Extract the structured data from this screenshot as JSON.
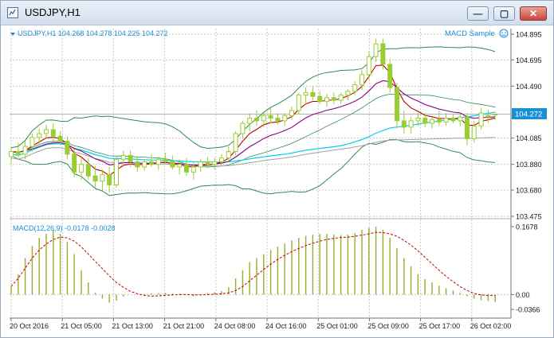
{
  "window": {
    "title": "USDJPY,H1",
    "buttons": {
      "minimize": "—",
      "restore": "▢",
      "close": "✕"
    }
  },
  "chart_data": {
    "type": "candlestick",
    "title": "USDJPY,H1",
    "header_values": "104.268 104.278 104.225 104.272",
    "header_label": "USDJPY,H1  104.268 104.278 104.225 104.272",
    "indicator_label": "MACD Sample",
    "current_price": "104.272",
    "price_ticks": [
      "104.895",
      "104.695",
      "104.490",
      "104.085",
      "103.880",
      "103.680",
      "103.475"
    ],
    "ylim": [
      103.475,
      104.895
    ],
    "x_ticks": [
      "20 Oct 2016",
      "21 Oct 05:00",
      "21 Oct 13:00",
      "21 Oct 21:00",
      "24 Oct 08:00",
      "24 Oct 16:00",
      "25 Oct 01:00",
      "25 Oct 09:00",
      "25 Oct 17:00",
      "26 Oct 02:00"
    ],
    "candles": [
      {
        "o": 103.94,
        "h": 104.02,
        "l": 103.88,
        "c": 103.98
      },
      {
        "o": 103.98,
        "h": 104.05,
        "l": 103.93,
        "c": 103.96
      },
      {
        "o": 103.96,
        "h": 104.06,
        "l": 103.92,
        "c": 104.02
      },
      {
        "o": 104.02,
        "h": 104.12,
        "l": 103.98,
        "c": 104.09
      },
      {
        "o": 104.09,
        "h": 104.16,
        "l": 104.03,
        "c": 104.12
      },
      {
        "o": 104.12,
        "h": 104.19,
        "l": 104.08,
        "c": 104.15
      },
      {
        "o": 104.15,
        "h": 104.2,
        "l": 104.05,
        "c": 104.1
      },
      {
        "o": 104.1,
        "h": 104.14,
        "l": 104.03,
        "c": 104.06
      },
      {
        "o": 104.06,
        "h": 104.1,
        "l": 103.92,
        "c": 103.96
      },
      {
        "o": 103.96,
        "h": 104.0,
        "l": 103.78,
        "c": 103.82
      },
      {
        "o": 103.82,
        "h": 103.93,
        "l": 103.76,
        "c": 103.88
      },
      {
        "o": 103.88,
        "h": 103.93,
        "l": 103.76,
        "c": 103.79
      },
      {
        "o": 103.79,
        "h": 103.87,
        "l": 103.7,
        "c": 103.75
      },
      {
        "o": 103.75,
        "h": 103.84,
        "l": 103.68,
        "c": 103.8
      },
      {
        "o": 103.8,
        "h": 103.86,
        "l": 103.66,
        "c": 103.72
      },
      {
        "o": 103.72,
        "h": 103.94,
        "l": 103.7,
        "c": 103.92
      },
      {
        "o": 103.92,
        "h": 103.99,
        "l": 103.86,
        "c": 103.95
      },
      {
        "o": 103.95,
        "h": 103.99,
        "l": 103.86,
        "c": 103.9
      },
      {
        "o": 103.9,
        "h": 103.94,
        "l": 103.82,
        "c": 103.86
      },
      {
        "o": 103.86,
        "h": 103.92,
        "l": 103.83,
        "c": 103.9
      },
      {
        "o": 103.9,
        "h": 103.96,
        "l": 103.86,
        "c": 103.88
      },
      {
        "o": 103.88,
        "h": 103.94,
        "l": 103.84,
        "c": 103.92
      },
      {
        "o": 103.92,
        "h": 103.97,
        "l": 103.88,
        "c": 103.9
      },
      {
        "o": 103.9,
        "h": 103.95,
        "l": 103.84,
        "c": 103.86
      },
      {
        "o": 103.86,
        "h": 103.92,
        "l": 103.8,
        "c": 103.88
      },
      {
        "o": 103.88,
        "h": 103.93,
        "l": 103.79,
        "c": 103.82
      },
      {
        "o": 103.82,
        "h": 103.9,
        "l": 103.76,
        "c": 103.86
      },
      {
        "o": 103.86,
        "h": 103.92,
        "l": 103.82,
        "c": 103.9
      },
      {
        "o": 103.9,
        "h": 103.94,
        "l": 103.85,
        "c": 103.88
      },
      {
        "o": 103.88,
        "h": 103.93,
        "l": 103.84,
        "c": 103.9
      },
      {
        "o": 103.9,
        "h": 103.96,
        "l": 103.87,
        "c": 103.93
      },
      {
        "o": 103.93,
        "h": 104.02,
        "l": 103.9,
        "c": 103.98
      },
      {
        "o": 103.98,
        "h": 104.14,
        "l": 103.95,
        "c": 104.12
      },
      {
        "o": 104.12,
        "h": 104.22,
        "l": 104.08,
        "c": 104.2
      },
      {
        "o": 104.2,
        "h": 104.28,
        "l": 104.14,
        "c": 104.24
      },
      {
        "o": 104.24,
        "h": 104.3,
        "l": 104.18,
        "c": 104.22
      },
      {
        "o": 104.22,
        "h": 104.28,
        "l": 104.17,
        "c": 104.26
      },
      {
        "o": 104.26,
        "h": 104.32,
        "l": 104.2,
        "c": 104.24
      },
      {
        "o": 104.24,
        "h": 104.28,
        "l": 104.19,
        "c": 104.22
      },
      {
        "o": 104.22,
        "h": 104.28,
        "l": 104.18,
        "c": 104.26
      },
      {
        "o": 104.26,
        "h": 104.33,
        "l": 104.23,
        "c": 104.3
      },
      {
        "o": 104.3,
        "h": 104.44,
        "l": 104.27,
        "c": 104.42
      },
      {
        "o": 104.42,
        "h": 104.48,
        "l": 104.36,
        "c": 104.44
      },
      {
        "o": 104.44,
        "h": 104.49,
        "l": 104.38,
        "c": 104.41
      },
      {
        "o": 104.41,
        "h": 104.45,
        "l": 104.35,
        "c": 104.37
      },
      {
        "o": 104.37,
        "h": 104.43,
        "l": 104.33,
        "c": 104.4
      },
      {
        "o": 104.4,
        "h": 104.44,
        "l": 104.35,
        "c": 104.38
      },
      {
        "o": 104.38,
        "h": 104.44,
        "l": 104.35,
        "c": 104.42
      },
      {
        "o": 104.42,
        "h": 104.47,
        "l": 104.38,
        "c": 104.45
      },
      {
        "o": 104.45,
        "h": 104.53,
        "l": 104.42,
        "c": 104.5
      },
      {
        "o": 104.5,
        "h": 104.62,
        "l": 104.46,
        "c": 104.58
      },
      {
        "o": 104.58,
        "h": 104.76,
        "l": 104.54,
        "c": 104.72
      },
      {
        "o": 104.72,
        "h": 104.86,
        "l": 104.68,
        "c": 104.82
      },
      {
        "o": 104.82,
        "h": 104.86,
        "l": 104.62,
        "c": 104.66
      },
      {
        "o": 104.66,
        "h": 104.7,
        "l": 104.44,
        "c": 104.48
      },
      {
        "o": 104.48,
        "h": 104.52,
        "l": 104.16,
        "c": 104.22
      },
      {
        "o": 104.22,
        "h": 104.3,
        "l": 104.12,
        "c": 104.17
      },
      {
        "o": 104.17,
        "h": 104.25,
        "l": 104.12,
        "c": 104.22
      },
      {
        "o": 104.22,
        "h": 104.28,
        "l": 104.18,
        "c": 104.24
      },
      {
        "o": 104.24,
        "h": 104.28,
        "l": 104.17,
        "c": 104.2
      },
      {
        "o": 104.2,
        "h": 104.25,
        "l": 104.16,
        "c": 104.23
      },
      {
        "o": 104.23,
        "h": 104.3,
        "l": 104.18,
        "c": 104.21
      },
      {
        "o": 104.21,
        "h": 104.28,
        "l": 104.18,
        "c": 104.24
      },
      {
        "o": 104.24,
        "h": 104.27,
        "l": 104.2,
        "c": 104.22
      },
      {
        "o": 104.22,
        "h": 104.27,
        "l": 104.18,
        "c": 104.25
      },
      {
        "o": 104.25,
        "h": 104.28,
        "l": 104.03,
        "c": 104.08
      },
      {
        "o": 104.08,
        "h": 104.22,
        "l": 104.05,
        "c": 104.18
      },
      {
        "o": 104.18,
        "h": 104.32,
        "l": 104.15,
        "c": 104.28
      },
      {
        "o": 104.26,
        "h": 104.31,
        "l": 104.2,
        "c": 104.25
      },
      {
        "o": 104.268,
        "h": 104.278,
        "l": 104.225,
        "c": 104.272
      }
    ],
    "macd": {
      "label": "MACD(12,26,9) -0.0178 -0.0028",
      "ticks": [
        "0.1678",
        "0.00",
        "-0.0366"
      ],
      "ylim": [
        -0.0366,
        0.1678
      ],
      "histogram": [
        0.02,
        0.05,
        0.09,
        0.12,
        0.14,
        0.15,
        0.16,
        0.15,
        0.13,
        0.1,
        0.06,
        0.03,
        0.005,
        -0.01,
        -0.02,
        -0.015,
        -0.005,
        0.0,
        0.0,
        0.002,
        0.003,
        0.004,
        0.004,
        0.003,
        0.002,
        0.0,
        -0.004,
        0.0,
        0.004,
        0.006,
        0.009,
        0.018,
        0.04,
        0.06,
        0.08,
        0.09,
        0.1,
        0.11,
        0.118,
        0.126,
        0.134,
        0.14,
        0.145,
        0.148,
        0.15,
        0.15,
        0.148,
        0.147,
        0.148,
        0.152,
        0.16,
        0.165,
        0.168,
        0.16,
        0.14,
        0.115,
        0.09,
        0.07,
        0.05,
        0.038,
        0.03,
        0.022,
        0.016,
        0.01,
        0.004,
        -0.004,
        -0.01,
        -0.014,
        -0.016,
        -0.018
      ],
      "signal": [
        0.02,
        0.04,
        0.065,
        0.09,
        0.11,
        0.125,
        0.136,
        0.142,
        0.14,
        0.132,
        0.118,
        0.1,
        0.082,
        0.064,
        0.046,
        0.03,
        0.018,
        0.008,
        0.002,
        -0.002,
        -0.004,
        -0.003,
        -0.002,
        -0.001,
        0.0,
        0.0,
        -0.001,
        -0.001,
        0.0,
        0.001,
        0.002,
        0.004,
        0.01,
        0.02,
        0.034,
        0.048,
        0.062,
        0.075,
        0.087,
        0.097,
        0.106,
        0.114,
        0.121,
        0.127,
        0.132,
        0.136,
        0.139,
        0.141,
        0.142,
        0.144,
        0.147,
        0.15,
        0.154,
        0.153,
        0.15,
        0.144,
        0.134,
        0.122,
        0.108,
        0.092,
        0.076,
        0.06,
        0.045,
        0.032,
        0.02,
        0.01,
        0.003,
        -0.001,
        -0.002,
        -0.0028
      ]
    }
  }
}
